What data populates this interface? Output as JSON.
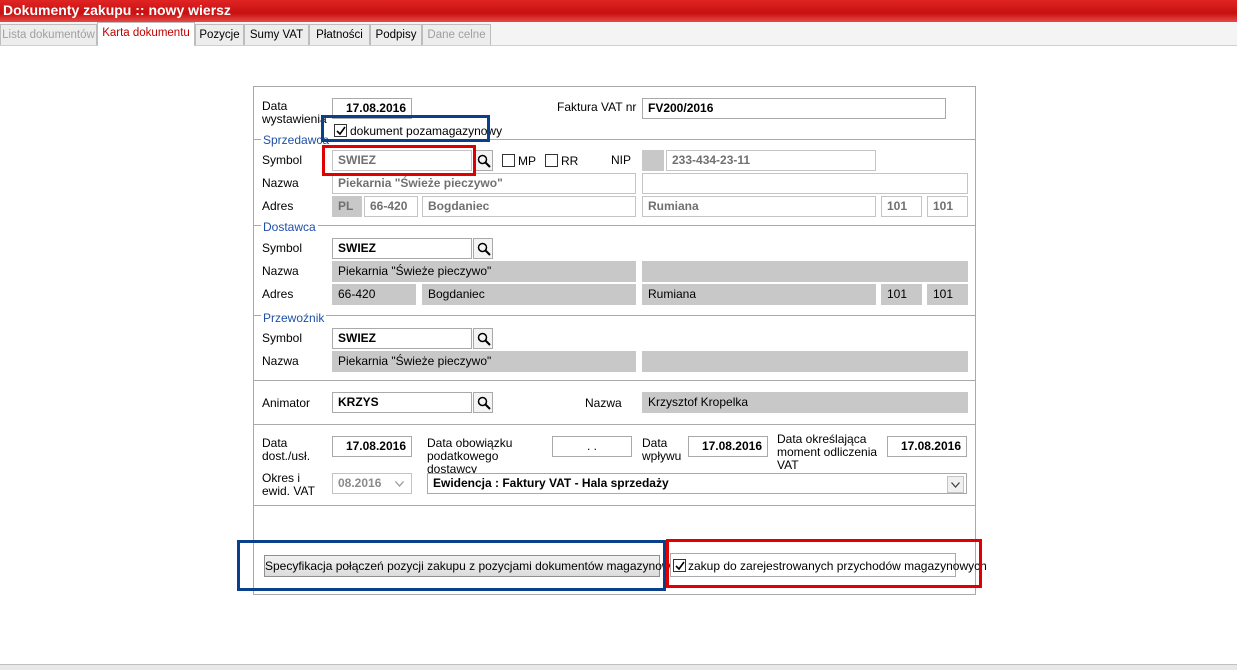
{
  "window": {
    "title": "Dokumenty zakupu :: nowy wiersz"
  },
  "tabs": [
    {
      "label": "Lista dokumentów",
      "state": "disabled"
    },
    {
      "label": "Karta dokumentu",
      "state": "active"
    },
    {
      "label": "Pozycje",
      "state": "normal"
    },
    {
      "label": "Sumy VAT",
      "state": "normal"
    },
    {
      "label": "Płatności",
      "state": "normal"
    },
    {
      "label": "Podpisy",
      "state": "normal"
    },
    {
      "label": "Dane celne",
      "state": "disabled"
    }
  ],
  "header": {
    "date_label": "Data wystawienia",
    "date_value": "17.08.2016",
    "invoice_label": "Faktura VAT nr",
    "invoice_value": "FV200/2016",
    "non_warehouse_label": "dokument pozamagazynowy",
    "non_warehouse_checked": true
  },
  "seller": {
    "section": "Sprzedawca",
    "symbol_label": "Symbol",
    "symbol_value": "SWIEZ",
    "mp_label": "MP",
    "rr_label": "RR",
    "nip_label": "NIP",
    "nip_value": "233-434-23-11",
    "name_label": "Nazwa",
    "name_value": "Piekarnia \"Świeże pieczywo\"",
    "name2_value": "",
    "address_label": "Adres",
    "country": "PL",
    "postal_code": "66-420",
    "city": "Bogdaniec",
    "street": "Rumiana",
    "house_no": "101",
    "flat_no": "101"
  },
  "supplier": {
    "section": "Dostawca",
    "symbol_label": "Symbol",
    "symbol_value": "SWIEZ",
    "name_label": "Nazwa",
    "name_value": "Piekarnia \"Świeże pieczywo\"",
    "name2_value": "",
    "address_label": "Adres",
    "postal_code": "66-420",
    "city": "Bogdaniec",
    "street": "Rumiana",
    "house_no": "101",
    "flat_no": "101"
  },
  "carrier": {
    "section": "Przewoźnik",
    "symbol_label": "Symbol",
    "symbol_value": "SWIEZ",
    "name_label": "Nazwa",
    "name_value": "Piekarnia \"Świeże pieczywo\"",
    "name2_value": ""
  },
  "animator": {
    "label": "Animator",
    "value": "KRZYS",
    "name_label": "Nazwa",
    "name_value": "Krzysztof Kropelka"
  },
  "dates": {
    "delivery_label": "Data dost./usł.",
    "delivery_value": "17.08.2016",
    "tax_obligation_label": "Data obowiązku podatkowego dostawcy",
    "tax_obligation_value": ". .",
    "receipt_label": "Data wpływu",
    "receipt_value": "17.08.2016",
    "deduction_label": "Data określająca moment odliczenia VAT",
    "deduction_value": "17.08.2016",
    "period_label": "Okres i ewid. VAT",
    "period_value": "08.2016",
    "register_value": "Ewidencja : Faktury VAT - Hala sprzedaży"
  },
  "footer": {
    "spec_button": "Specyfikacja połączeń pozycji zakupu z pozycjami dokumentów magazynowych",
    "registered_label": "zakup do zarejestrowanych przychodów magazynowych",
    "registered_checked": true
  }
}
